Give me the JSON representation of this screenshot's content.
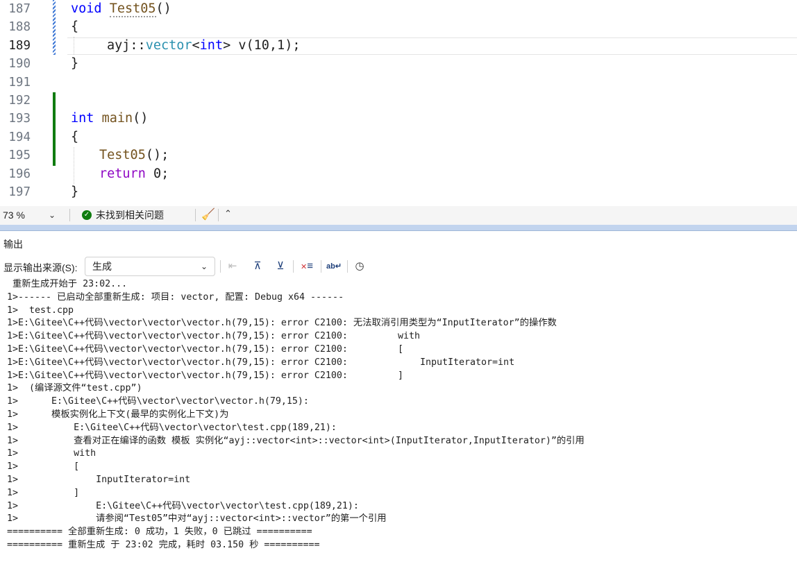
{
  "editor": {
    "current_line": "189",
    "lines": [
      {
        "num": "187"
      },
      {
        "num": "188"
      },
      {
        "num": "189"
      },
      {
        "num": "190"
      },
      {
        "num": "191"
      },
      {
        "num": "192"
      },
      {
        "num": "193"
      },
      {
        "num": "194"
      },
      {
        "num": "195"
      },
      {
        "num": "196"
      },
      {
        "num": "197"
      }
    ],
    "tokens": {
      "void": "void",
      "test05": "Test05",
      "parens": "()",
      "open_brace": "{",
      "close_brace": "}",
      "ns": "ayj::",
      "vector": "vector",
      "lt": "<",
      "int": "int",
      "gt": ">",
      "rest_189": " v(10,1);",
      "main": "main",
      "call_test05": "Test05",
      "call_rest": "();",
      "return": "return",
      "return_rest": " 0;"
    }
  },
  "statusbar": {
    "zoom": "73 %",
    "issues": "未找到相关问题"
  },
  "output": {
    "title": "输出",
    "source_label": "显示输出来源(S):",
    "source_value": "生成",
    "lines": [
      " 重新生成开始于 23:02...",
      "1>------ 已启动全部重新生成: 项目: vector, 配置: Debug x64 ------",
      "1>  test.cpp",
      "1>E:\\Gitee\\C++代码\\vector\\vector\\vector.h(79,15): error C2100: 无法取消引用类型为“InputIterator”的操作数",
      "1>E:\\Gitee\\C++代码\\vector\\vector\\vector.h(79,15): error C2100:         with",
      "1>E:\\Gitee\\C++代码\\vector\\vector\\vector.h(79,15): error C2100:         [",
      "1>E:\\Gitee\\C++代码\\vector\\vector\\vector.h(79,15): error C2100:             InputIterator=int",
      "1>E:\\Gitee\\C++代码\\vector\\vector\\vector.h(79,15): error C2100:         ]",
      "1>  (编译源文件“test.cpp”)",
      "1>      E:\\Gitee\\C++代码\\vector\\vector\\vector.h(79,15):",
      "1>      模板实例化上下文(最早的实例化上下文)为",
      "1>          E:\\Gitee\\C++代码\\vector\\vector\\test.cpp(189,21):",
      "1>          查看对正在编译的函数 模板 实例化“ayj::vector<int>::vector<int>(InputIterator,InputIterator)”的引用",
      "1>          with",
      "1>          [",
      "1>              InputIterator=int",
      "1>          ]",
      "1>              E:\\Gitee\\C++代码\\vector\\vector\\test.cpp(189,21):",
      "1>              请参阅“Test05”中对“ayj::vector<int>::vector”的第一个引用",
      "========== 全部重新生成: 0 成功，1 失败，0 已跳过 ==========",
      "========== 重新生成 于 23:02 完成，耗时 03.150 秒 =========="
    ]
  }
}
